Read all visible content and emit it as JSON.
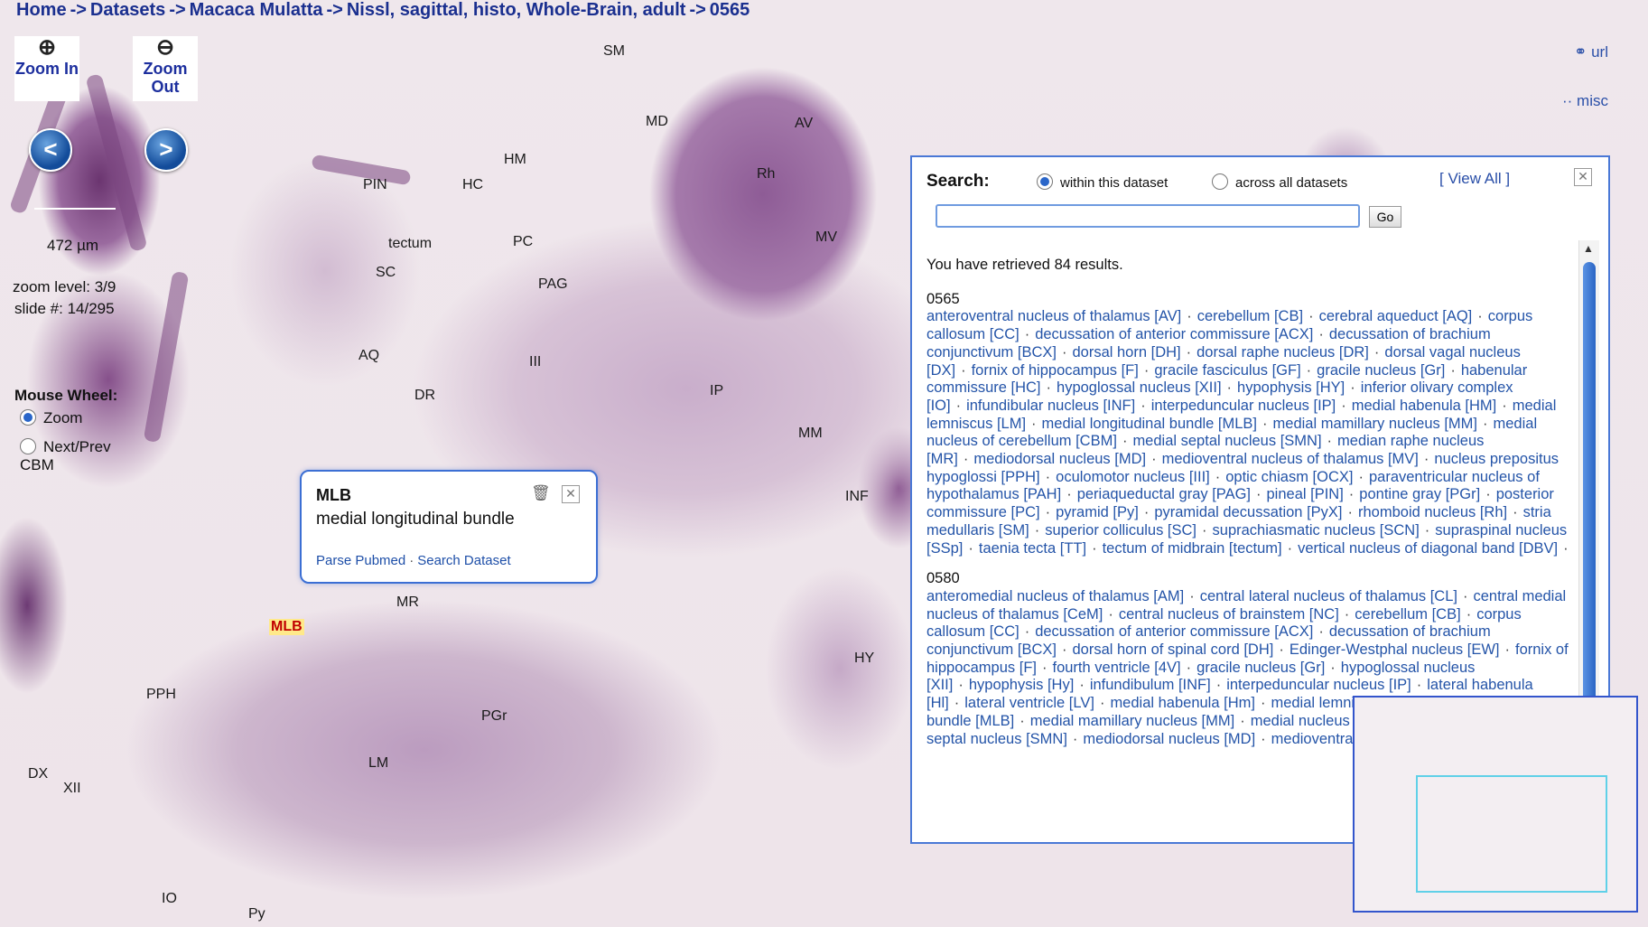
{
  "breadcrumb": [
    "Home",
    "Datasets",
    "Macaca Mulatta",
    "Nissl, sagittal, histo, Whole-Brain, adult",
    "0565"
  ],
  "breadcrumb_sep": "->",
  "toolbar": {
    "zoom_in": "Zoom In",
    "zoom_out": "Zoom Out",
    "prev": "<",
    "next": ">"
  },
  "status": {
    "scale": "472 µm",
    "zoom_level": "zoom level: 3/9",
    "slide": "slide #: 14/295"
  },
  "mouse_wheel": {
    "label": "Mouse Wheel:",
    "zoom": "Zoom",
    "nextprev": "Next/Prev"
  },
  "cbm_label": "CBM",
  "right_links": {
    "url": "url",
    "misc": "misc"
  },
  "labels": [
    {
      "t": "SM"
    },
    {
      "t": "MD"
    },
    {
      "t": "AV"
    },
    {
      "t": "HM"
    },
    {
      "t": "Rh"
    },
    {
      "t": "PIN"
    },
    {
      "t": "HC"
    },
    {
      "t": "MV"
    },
    {
      "t": "tectum"
    },
    {
      "t": "PC"
    },
    {
      "t": "SC"
    },
    {
      "t": "PAG"
    },
    {
      "t": "AQ"
    },
    {
      "t": "III"
    },
    {
      "t": "IP"
    },
    {
      "t": "DR"
    },
    {
      "t": "MM"
    },
    {
      "t": "INF"
    },
    {
      "t": "MR"
    },
    {
      "t": "MLB"
    },
    {
      "t": "HY"
    },
    {
      "t": "PPH"
    },
    {
      "t": "PGr"
    },
    {
      "t": "LM"
    },
    {
      "t": "DX"
    },
    {
      "t": "XII"
    },
    {
      "t": "IO"
    },
    {
      "t": "Py"
    }
  ],
  "tooltip": {
    "abbr": "MLB",
    "name": "medial longitudinal bundle",
    "link1": "Parse Pubmed",
    "link2": "Search Dataset",
    "sep": "·"
  },
  "search": {
    "label": "Search:",
    "opt_within": "within this dataset",
    "opt_across": "across all datasets",
    "view_all": "[ View All ]",
    "input_value": "",
    "go": "Go",
    "result_count": "You have retrieved 84 results.",
    "groups": [
      {
        "slide": "0565",
        "items": [
          "anteroventral nucleus of thalamus [AV]",
          "cerebellum [CB]",
          "cerebral aqueduct [AQ]",
          "corpus callosum [CC]",
          "decussation of anterior commissure [ACX]",
          "decussation of brachium conjunctivum [BCX]",
          "dorsal horn [DH]",
          "dorsal raphe nucleus [DR]",
          "dorsal vagal nucleus [DX]",
          "fornix of hippocampus [F]",
          "gracile fasciculus [GF]",
          "gracile nucleus [Gr]",
          "habenular commissure [HC]",
          "hypoglossal nucleus [XII]",
          "hypophysis [HY]",
          "inferior olivary complex [IO]",
          "infundibular nucleus [INF]",
          "interpeduncular nucleus [IP]",
          "medial habenula [HM]",
          "medial lemniscus [LM]",
          "medial longitudinal bundle [MLB]",
          "medial mamillary nucleus [MM]",
          "medial nucleus of cerebellum [CBM]",
          "medial septal nucleus [SMN]",
          "median raphe nucleus [MR]",
          "mediodorsal nucleus [MD]",
          "medioventral nucleus of thalamus [MV]",
          "nucleus prepositus hypoglossi [PPH]",
          "oculomotor nucleus [III]",
          "optic chiasm [OCX]",
          "paraventricular nucleus of hypothalamus [PAH]",
          "periaqueductal gray [PAG]",
          "pineal [PIN]",
          "pontine gray [PGr]",
          "posterior commissure [PC]",
          "pyramid [Py]",
          "pyramidal decussation [PyX]",
          "rhomboid nucleus [Rh]",
          "stria medullaris [SM]",
          "superior colliculus [SC]",
          "suprachiasmatic nucleus [SCN]",
          "supraspinal nucleus [SSp]",
          "taenia tecta [TT]",
          "tectum of midbrain [tectum]",
          "vertical nucleus of diagonal band [DBV]"
        ]
      },
      {
        "slide": "0580",
        "items": [
          "anteromedial nucleus of thalamus [AM]",
          "central lateral nucleus of thalamus [CL]",
          "central medial nucleus of thalamus [CeM]",
          "central nucleus of brainstem [NC]",
          "cerebellum [CB]",
          "corpus callosum [CC]",
          "decussation of anterior commissure [ACX]",
          "decussation of brachium conjunctivum [BCX]",
          "dorsal horn of spinal cord [DH]",
          "Edinger-Westphal nucleus [EW]",
          "fornix of hippocampus [F]",
          "fourth ventricle [4V]",
          "gracile nucleus [Gr]",
          "hypoglossal nucleus [XII]",
          "hypophysis [Hy]",
          "infundibulum [INF]",
          "interpeduncular nucleus [IP]",
          "lateral habenula [Hl]",
          "lateral ventricle [LV]",
          "medial habenula [Hm]",
          "medial lemniscus [LM]",
          "medial longitudinal bundle [MLB]",
          "medial mamillary nucleus [MM]",
          "medial nucleus of cerebellum [CBM]",
          "medial septal nucleus [SMN]",
          "mediodorsal nucleus [MD]",
          "medioventral nucleus of thalamus [MV]"
        ]
      }
    ]
  }
}
